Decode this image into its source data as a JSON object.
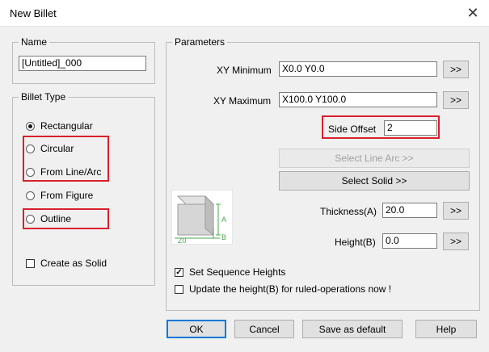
{
  "window": {
    "title": "New Billet",
    "close_glyph": "✕"
  },
  "name_group": {
    "legend": "Name",
    "value": "[Untitled]_000"
  },
  "billet_type": {
    "legend": "Billet Type",
    "options": [
      {
        "label": "Rectangular",
        "selected": true
      },
      {
        "label": "Circular",
        "selected": false
      },
      {
        "label": "From Line/Arc",
        "selected": false
      },
      {
        "label": "From Figure",
        "selected": false
      },
      {
        "label": "Outline",
        "selected": false
      }
    ],
    "create_solid": {
      "label": "Create as Solid",
      "checked": false
    }
  },
  "parameters": {
    "legend": "Parameters",
    "xy_min": {
      "label": "XY Minimum",
      "value": "X0.0 Y0.0",
      "button": ">>"
    },
    "xy_max": {
      "label": "XY Maximum",
      "value": "X100.0 Y100.0",
      "button": ">>"
    },
    "side_offset": {
      "label": "Side Offset",
      "value": "2"
    },
    "select_line_arc": "Select Line Arc >>",
    "select_solid": "Select Solid >>",
    "thickness": {
      "label": "Thickness(A)",
      "value": "20.0",
      "button": ">>"
    },
    "height": {
      "label": "Height(B)",
      "value": "0.0",
      "button": ">>"
    },
    "diagram": {
      "a": "A",
      "b": "B",
      "z0": "Z0"
    },
    "set_seq": {
      "label": "Set Sequence Heights",
      "checked": true
    },
    "update_height": {
      "label": "Update the height(B) for ruled-operations now !",
      "checked": false
    }
  },
  "footer": {
    "ok": "OK",
    "cancel": "Cancel",
    "save_default": "Save as default",
    "help": "Help"
  },
  "colors": {
    "highlight": "#d9202c",
    "dialog_bg": "#f0f0f0",
    "diagram_green": "#4ca64c"
  }
}
